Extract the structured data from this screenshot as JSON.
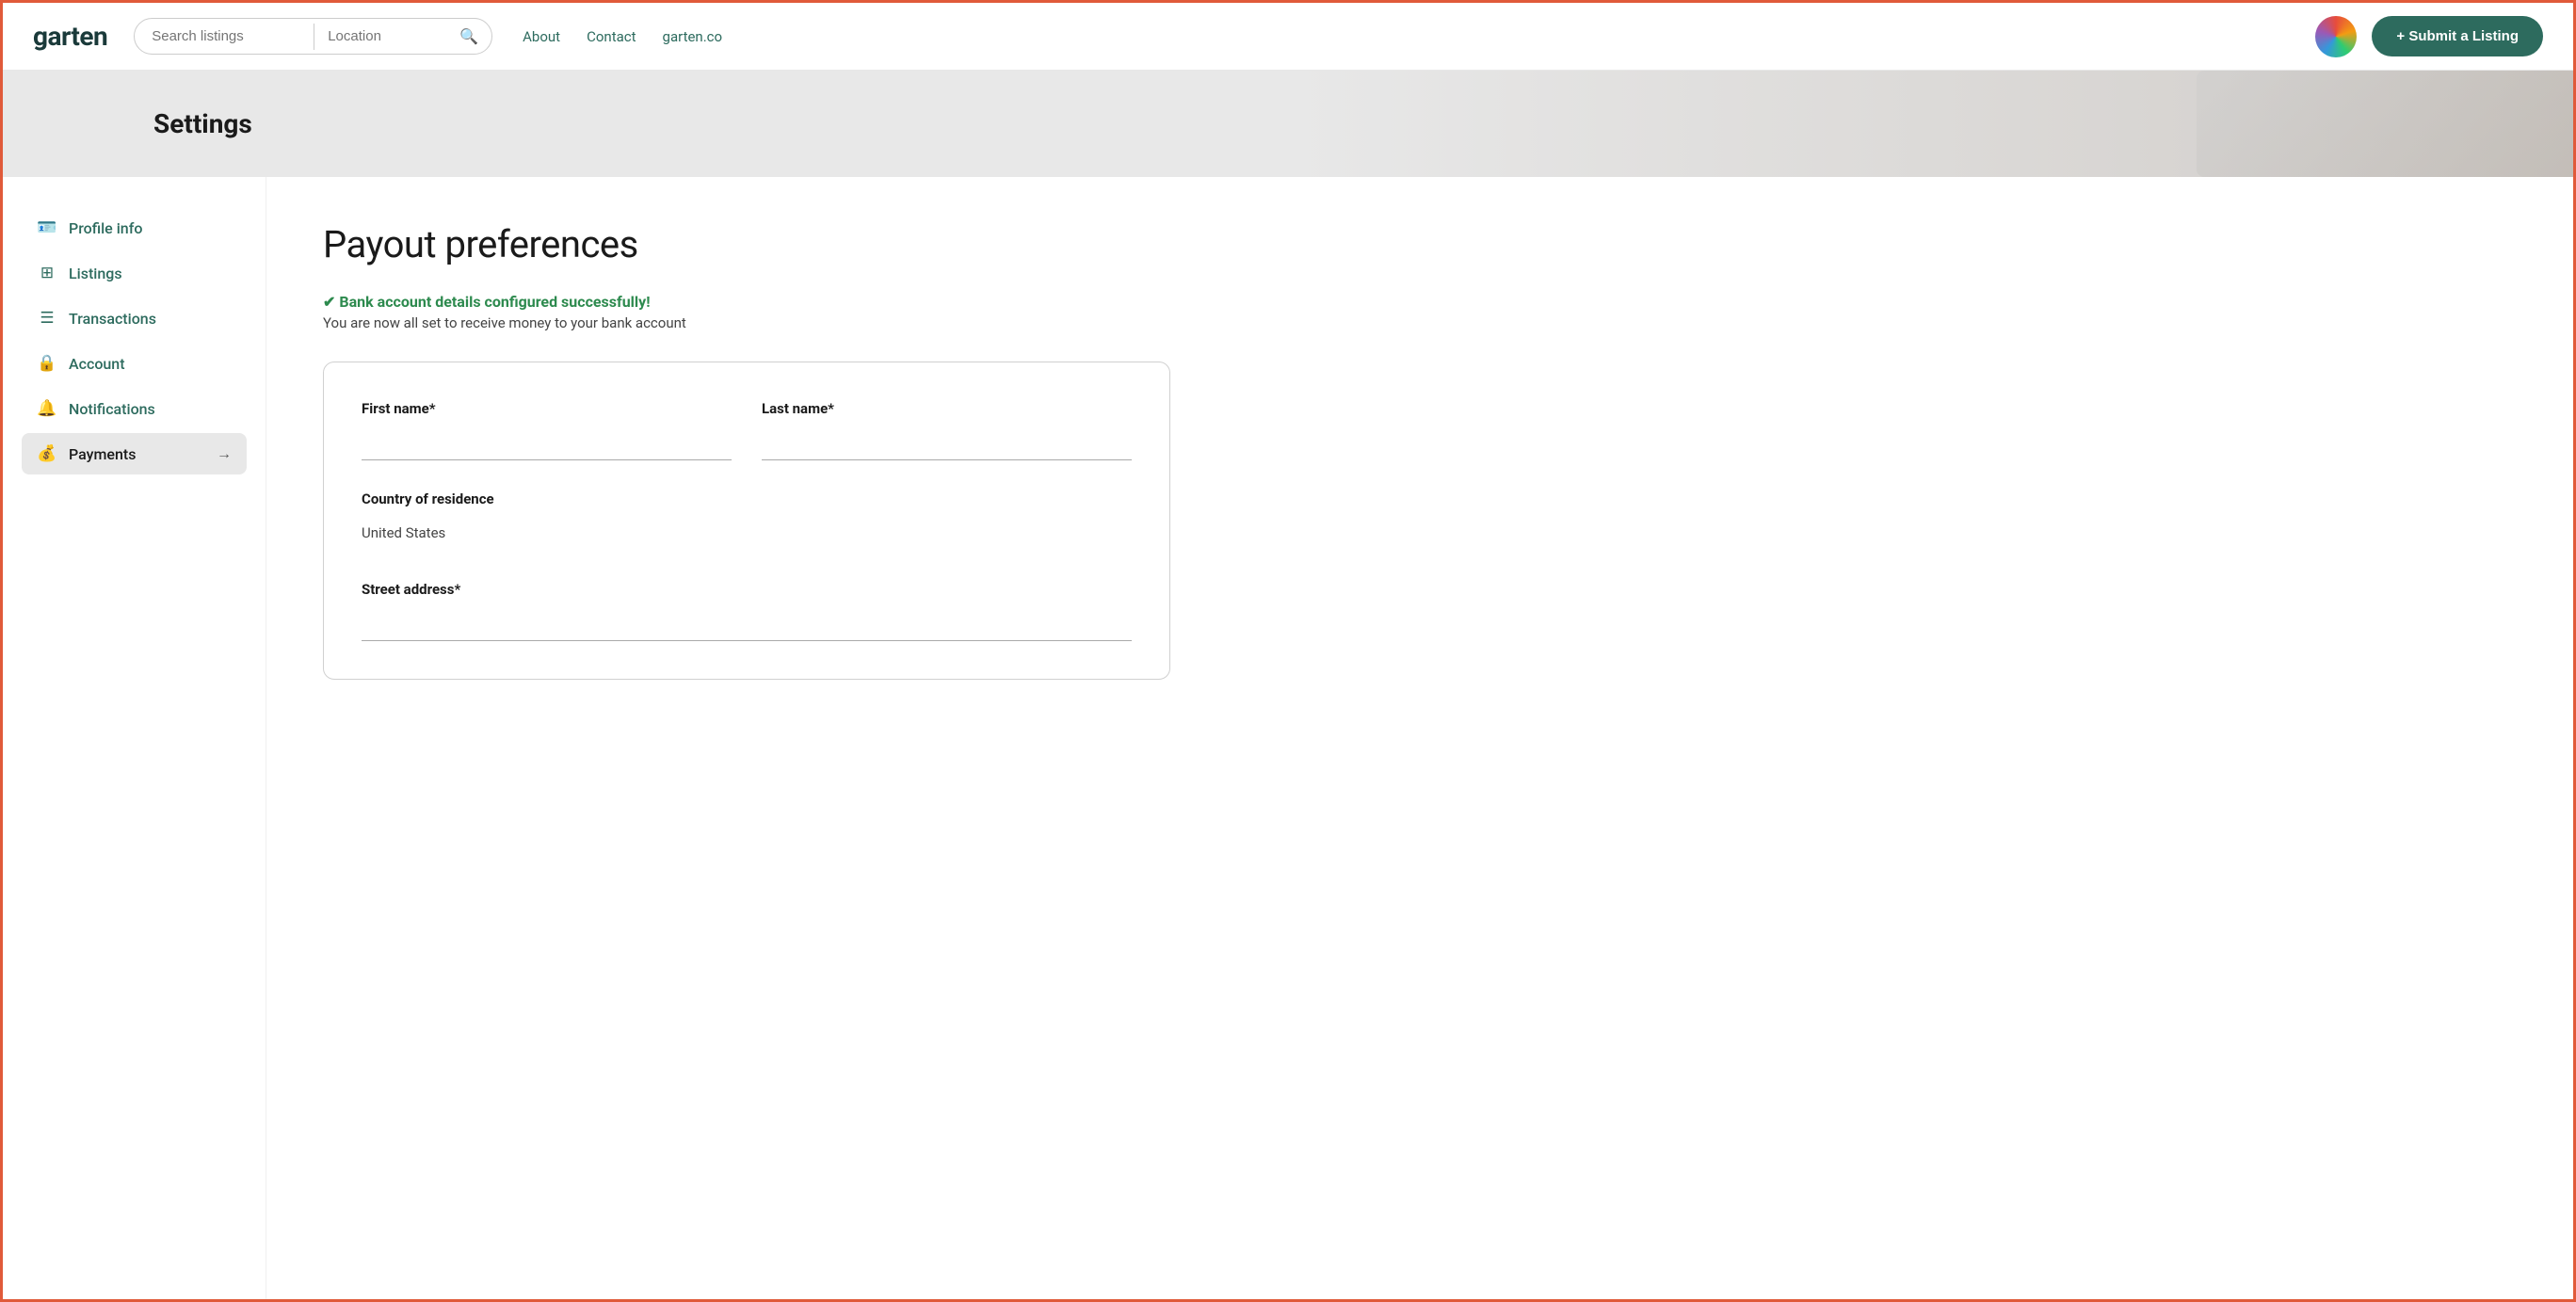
{
  "header": {
    "logo": "garten",
    "search_placeholder": "Search listings",
    "location_placeholder": "Location",
    "nav": [
      {
        "label": "About",
        "href": "#"
      },
      {
        "label": "Contact",
        "href": "#"
      },
      {
        "label": "garten.co",
        "href": "#"
      }
    ],
    "submit_btn": "+ Submit a Listing"
  },
  "settings_hero": {
    "title": "Settings"
  },
  "sidebar": {
    "items": [
      {
        "label": "Profile info",
        "icon": "🪪",
        "active": false
      },
      {
        "label": "Listings",
        "icon": "⊞",
        "active": false
      },
      {
        "label": "Transactions",
        "icon": "≡",
        "active": false
      },
      {
        "label": "Account",
        "icon": "🔒",
        "active": false
      },
      {
        "label": "Notifications",
        "icon": "🔔",
        "active": false
      },
      {
        "label": "Payments",
        "icon": "💰",
        "active": true
      }
    ]
  },
  "content": {
    "page_title": "Payout preferences",
    "success_title": "✔ Bank account details configured successfully!",
    "success_sub": "You are now all set to receive money to your bank account",
    "form": {
      "first_name_label": "First name*",
      "last_name_label": "Last name*",
      "country_label": "Country of residence",
      "country_value": "United States",
      "street_label": "Street address*"
    }
  }
}
